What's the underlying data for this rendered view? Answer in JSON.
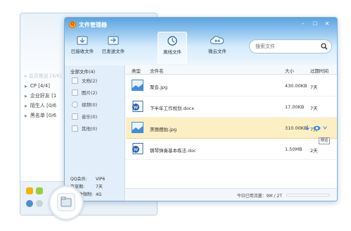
{
  "qq_panel": {
    "rows": [
      {
        "label": "▸ 会员推送 [4/6]",
        "faded": true
      },
      {
        "label": "CP [4/4]",
        "faded": false
      },
      {
        "label": "企业好友 [1",
        "faded": false
      },
      {
        "label": "陌生人 [0/6",
        "faded": false
      },
      {
        "label": "黑名单 [0/6",
        "faded": false
      }
    ]
  },
  "window": {
    "title": "文件管理器",
    "min_glyph": "–",
    "max_glyph": "□",
    "close_glyph": "✕"
  },
  "toolbar": {
    "items": [
      {
        "label": "已接收文件",
        "icon": "received-files-icon",
        "active": false
      },
      {
        "label": "已发送文件",
        "icon": "sent-files-icon",
        "active": false
      },
      {
        "label": "离线文件",
        "icon": "offline-files-icon",
        "active": true
      },
      {
        "label": "微云文件",
        "icon": "weiyun-cloud-icon",
        "active": false
      }
    ]
  },
  "search": {
    "placeholder": "搜索文件"
  },
  "sidebar": {
    "header": "全部文件(4)",
    "items": [
      {
        "label": "文档(2)",
        "icon": "document-icon"
      },
      {
        "label": "图片(2)",
        "icon": "image-icon"
      },
      {
        "label": "视频(0)",
        "icon": "video-icon"
      },
      {
        "label": "音乐(0)",
        "icon": "music-icon"
      },
      {
        "label": "其他(0)",
        "icon": "other-icon"
      }
    ],
    "info": [
      {
        "key": "QQ会员:",
        "value": "VIP6"
      },
      {
        "key": "存放期:",
        "value": "7天"
      },
      {
        "key": "单文件限制:",
        "value": "4G"
      }
    ]
  },
  "table": {
    "headers": [
      "类型",
      "文件名",
      "大小",
      "过期时间"
    ],
    "rows": [
      {
        "name": "聚会.jpg",
        "size": "430.00KB",
        "expire": "7天",
        "kind": "image",
        "selected": false
      },
      {
        "name": "下半年工作规划.docx",
        "size": "17.00KB",
        "expire": "7天",
        "kind": "doc",
        "selected": false
      },
      {
        "name": "美丽摆拍.jpg",
        "size": "310.00KB",
        "expire": "7天",
        "kind": "image",
        "selected": true
      },
      {
        "name": "钢琴弹奏基本练法.doc",
        "size": "1.50MB",
        "expire": "2天",
        "kind": "doc",
        "selected": false
      }
    ]
  },
  "tooltip": "预览",
  "status": {
    "text": "今日已用流量：9M / 2T",
    "usage_fraction": 0.01
  },
  "colors": {
    "title_bar": "#5ba3e0",
    "selected_row": "#fdefc4",
    "sidebar_bg": "#e2eef9",
    "accent": "#3a8ee6"
  }
}
